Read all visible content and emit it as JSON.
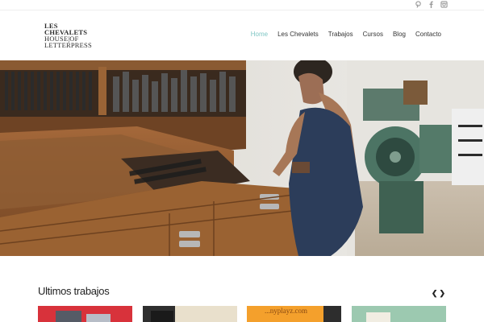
{
  "logo": {
    "line1": "LES",
    "line2": "CHEVALETS",
    "line3": "HOUSE|OF",
    "line4": "LETTERPRESS"
  },
  "social": [
    {
      "icon": "pinterest-icon"
    },
    {
      "icon": "facebook-icon"
    },
    {
      "icon": "instagram-icon"
    }
  ],
  "nav": {
    "items": [
      {
        "label": "Home",
        "active": true
      },
      {
        "label": "Les Chevalets"
      },
      {
        "label": "Trabajos"
      },
      {
        "label": "Cursos"
      },
      {
        "label": "Blog"
      },
      {
        "label": "Contacto"
      }
    ]
  },
  "colors": {
    "accent": "#7fc6c4",
    "text": "#333333"
  },
  "section": {
    "title": "Ultimos trabajos",
    "prev_icon": "chevron-left-icon",
    "next_icon": "chevron-right-icon"
  },
  "thumbs": [
    {
      "thumb_text": ""
    },
    {
      "thumb_text": ""
    },
    {
      "thumb_text": "...nyplayz.com"
    },
    {
      "thumb_text": ""
    }
  ]
}
